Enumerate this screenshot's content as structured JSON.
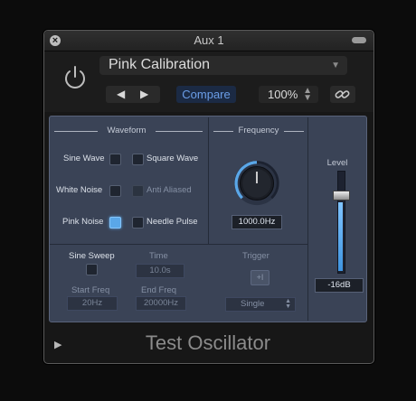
{
  "window": {
    "title": "Aux 1"
  },
  "header": {
    "preset": "Pink Calibration",
    "prev_label": "◀",
    "next_label": "▶",
    "compare_label": "Compare",
    "zoom": "100%"
  },
  "waveform": {
    "header": "Waveform",
    "sine_wave": "Sine Wave",
    "square_wave": "Square Wave",
    "white_noise": "White Noise",
    "anti_aliased": "Anti Aliased",
    "pink_noise": "Pink Noise",
    "needle_pulse": "Needle Pulse",
    "selected": "Pink Noise"
  },
  "frequency": {
    "header": "Frequency",
    "value": "1000.0Hz"
  },
  "level": {
    "header": "Level",
    "value": "-16dB",
    "fill_fraction": 0.68
  },
  "sweep": {
    "label": "Sine Sweep",
    "time_label": "Time",
    "time_value": "10.0s",
    "start_label": "Start Freq",
    "start_value": "20Hz",
    "end_label": "End Freq",
    "end_value": "20000Hz",
    "trigger_label": "Trigger",
    "trigger_button": "+I",
    "trigger_mode": "Single"
  },
  "footer": {
    "plugin_name": "Test Oscillator"
  },
  "colors": {
    "accent": "#5aa7e8",
    "compare": "#6b9ee8",
    "panel": "#3a4356"
  }
}
